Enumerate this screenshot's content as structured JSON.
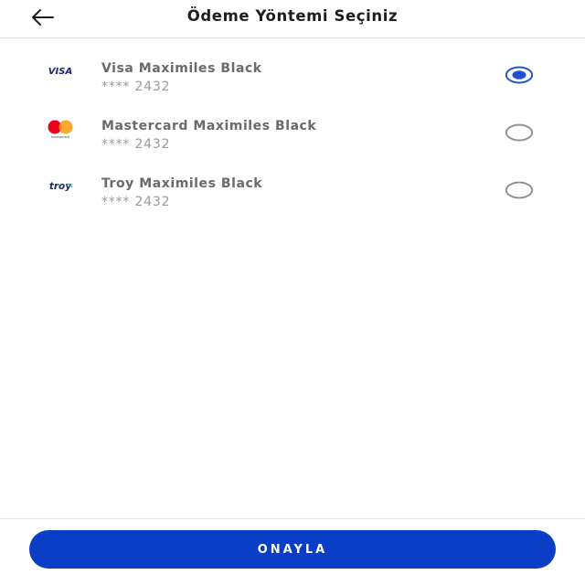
{
  "header": {
    "title": "Ödeme Yöntemi Seçiniz",
    "back_icon": "arrow-left-icon"
  },
  "cards": [
    {
      "brand": "visa",
      "logo_text": "VISA",
      "name": "Visa Maximiles Black",
      "number": "**** 2432",
      "selected": true
    },
    {
      "brand": "mastercard",
      "logo_text": "mastercard",
      "name": "Mastercard Maximiles Black",
      "number": "**** 2432",
      "selected": false
    },
    {
      "brand": "troy",
      "logo_text": "troy",
      "name": "Troy Maximiles Black",
      "number": "**** 2432",
      "selected": false
    }
  ],
  "footer": {
    "confirm_label": "ONAYLA"
  },
  "colors": {
    "accent": "#0a3ec7",
    "radio_selected": "#1f4fcf",
    "radio_unselected": "#8f8f8f",
    "visa_blue": "#1a1f71",
    "mc_red": "#eb001b",
    "mc_orange": "#f79e1b",
    "troy_navy": "#1c2a5a",
    "troy_teal": "#25b1c6"
  }
}
